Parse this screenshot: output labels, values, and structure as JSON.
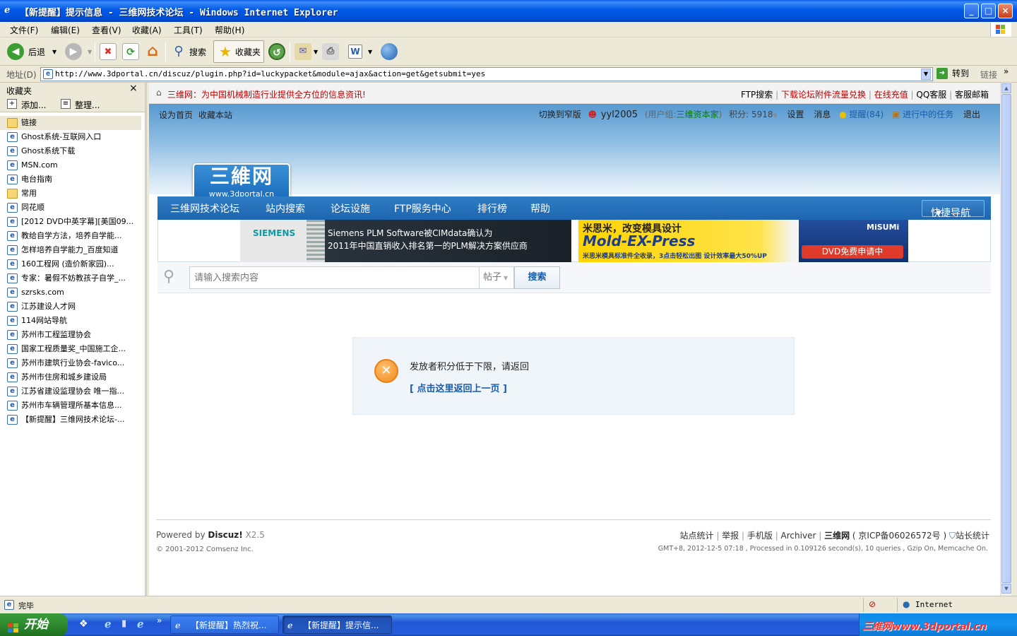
{
  "window": {
    "title": "【新提醒】提示信息 - 三维网技术论坛 - Windows Internet Explorer",
    "controls": {
      "minimize": "_",
      "maximize": "□",
      "close": "×"
    }
  },
  "menubar": {
    "items": [
      "文件(F)",
      "编辑(E)",
      "查看(V)",
      "收藏(A)",
      "工具(T)",
      "帮助(H)"
    ]
  },
  "toolbar": {
    "back_label": "后退",
    "search_label": "搜索",
    "favorites_label": "收藏夹"
  },
  "addressbar": {
    "label": "地址(D)",
    "url": "http://www.3dportal.cn/discuz/plugin.php?id=luckypacket&module=ajax&action=get&getsubmit=yes",
    "go_label": "转到",
    "links_label": "链接"
  },
  "favorites": {
    "title": "收藏夹",
    "close": "×",
    "add_label": "添加...",
    "organize_label": "整理...",
    "items": [
      {
        "label": "链接",
        "type": "folder"
      },
      {
        "label": "Ghost系统-互联网入口",
        "type": "page"
      },
      {
        "label": "Ghost系统下载",
        "type": "page"
      },
      {
        "label": "MSN.com",
        "type": "page"
      },
      {
        "label": "电台指南",
        "type": "page"
      },
      {
        "label": "常用",
        "type": "folder"
      },
      {
        "label": "同花顺",
        "type": "page"
      },
      {
        "label": "[2012 DVD中英字幕][美国09...",
        "type": "page"
      },
      {
        "label": "教给自学方法，培养自学能...",
        "type": "page"
      },
      {
        "label": "怎样培养自学能力_百度知道",
        "type": "page"
      },
      {
        "label": "160工程网 (造价新家园)...",
        "type": "page"
      },
      {
        "label": "专家：暑假不妨教孩子自学_...",
        "type": "page"
      },
      {
        "label": "szrsks.com",
        "type": "page"
      },
      {
        "label": "江苏建设人才网",
        "type": "page"
      },
      {
        "label": "114网站导航",
        "type": "page"
      },
      {
        "label": "苏州市工程监理协会",
        "type": "page"
      },
      {
        "label": "国家工程质量奖_中国施工企...",
        "type": "page"
      },
      {
        "label": "苏州市建筑行业协会-favico...",
        "type": "page"
      },
      {
        "label": "苏州市住房和城乡建设局",
        "type": "page"
      },
      {
        "label": "江苏省建设监理协会 唯一指...",
        "type": "page"
      },
      {
        "label": "苏州市车辆管理所基本信息...",
        "type": "page"
      },
      {
        "label": "【新提醒】三维网技术论坛-...",
        "type": "page"
      }
    ]
  },
  "site": {
    "topbar": {
      "slogan": "三维网：为中国机械制造行业提供全方位的信息资讯!",
      "links": [
        "FTP搜索",
        "下载论坛附件流量兑换",
        "在线充值",
        "QQ客服",
        "客服邮箱"
      ]
    },
    "userbar": {
      "set_home": "设为首页",
      "bookmark": "收藏本站",
      "switch_width": "切换到窄版",
      "username": "yyl2005",
      "group_prefix": "(用户组:",
      "group": "三维资本家",
      "group_suffix": ")",
      "points": "积分: 5918",
      "settings": "设置",
      "messages": "消息",
      "reminders": "提醒(84)",
      "tasks": "进行中的任务",
      "logout": "退出"
    },
    "logo": {
      "main": "三維网",
      "sub": "www.3dportal.cn"
    },
    "nav": {
      "items": [
        "三维网技术论坛",
        "站内搜索",
        "论坛设施",
        "FTP服务中心",
        "排行榜",
        "帮助"
      ],
      "quick_nav": "快捷导航"
    },
    "banner": {
      "siemens_brand": "SIEMENS",
      "siemens_line1": "Siemens PLM Software被CIMdata确认为",
      "siemens_line2": "2011年中国直销收入排名第一的PLM解决方案供应商",
      "misumi_title": "米思米，改变模具设计",
      "misumi_product": "Mold-EX-Press",
      "misumi_sub": "米思米模具标准件全收录，3点击轻松出图 设计效率最大50%UP",
      "misumi_brand": "MiSUMi",
      "misumi_dvd": "DVD免费申请中"
    },
    "search": {
      "placeholder": "请输入搜索内容",
      "type": "帖子",
      "button": "搜索"
    },
    "message": {
      "text": "发放者积分低于下限，请返回",
      "link": "[ 点击这里返回上一页 ]"
    },
    "footer": {
      "powered_prefix": "Powered by ",
      "powered_brand": "Discuz!",
      "version": " X2.5",
      "copyright": "© 2001-2012 Comsenz Inc.",
      "links": [
        "站点统计",
        "举报",
        "手机版",
        "Archiver"
      ],
      "site_name": "三维网",
      "icp": "( 京ICP备06026572号 )",
      "webmaster_stats": "站长统计",
      "timing": "GMT+8, 2012-12-5 07:18 , Processed in 0.109126 second(s), 10 queries , Gzip On, Memcache On."
    }
  },
  "statusbar": {
    "text": "完毕",
    "zone": "Internet"
  },
  "taskbar": {
    "start": "开始",
    "tasks": [
      "【新提醒】热烈祝...",
      "【新提醒】提示信..."
    ],
    "watermark": "三维网www.3dportal.cn"
  },
  "colors": {
    "titlebar": "#0058E6",
    "nav_blue": "#1E66B0",
    "link_red": "#C00000",
    "group_green": "#008000",
    "taskbar": "#245EDC"
  }
}
